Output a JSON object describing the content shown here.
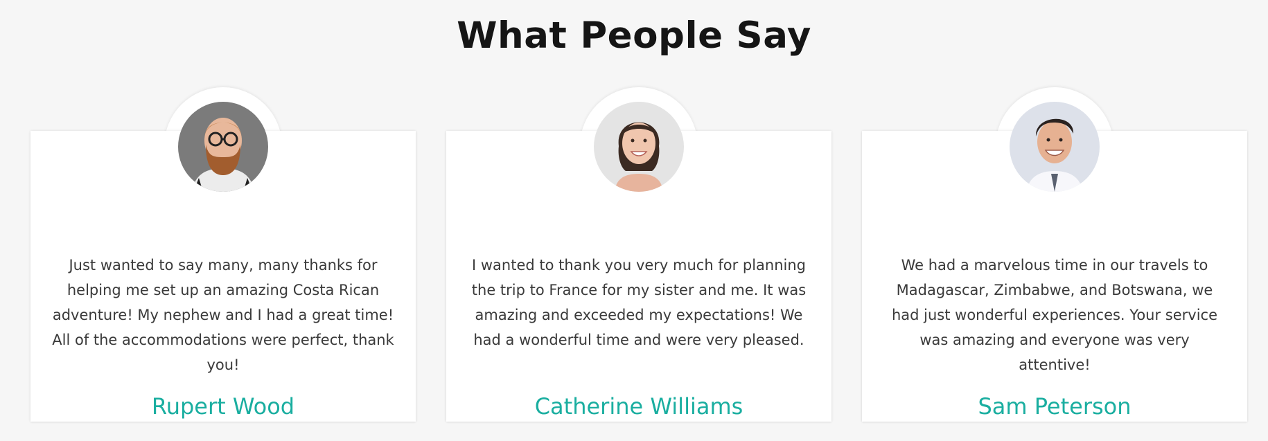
{
  "section": {
    "title": "What People Say"
  },
  "colors": {
    "background": "#f6f6f6",
    "card": "#ffffff",
    "accent_name": "#1aaea0",
    "title_text": "#151515",
    "body_text": "#3a3a3a"
  },
  "testimonials": [
    {
      "icon": "avatar-bearded-man-glasses",
      "quote": "Just wanted to say many, many thanks for helping me set up an amazing Costa Rican adventure! My nephew and I had a great time! All of the accommodations were perfect, thank you!",
      "name": "Rupert Wood"
    },
    {
      "icon": "avatar-smiling-woman",
      "quote": "I wanted to thank you very much for planning the trip to France for my sister and me. It was amazing and exceeded my expectations! We had a wonderful time and were very pleased.",
      "name": "Catherine Williams"
    },
    {
      "icon": "avatar-smiling-man",
      "quote": "We had a marvelous time in our travels to Madagascar, Zimbabwe, and Botswana, we had just wonderful experiences. Your service was amazing and everyone was very attentive!",
      "name": "Sam Peterson"
    }
  ]
}
